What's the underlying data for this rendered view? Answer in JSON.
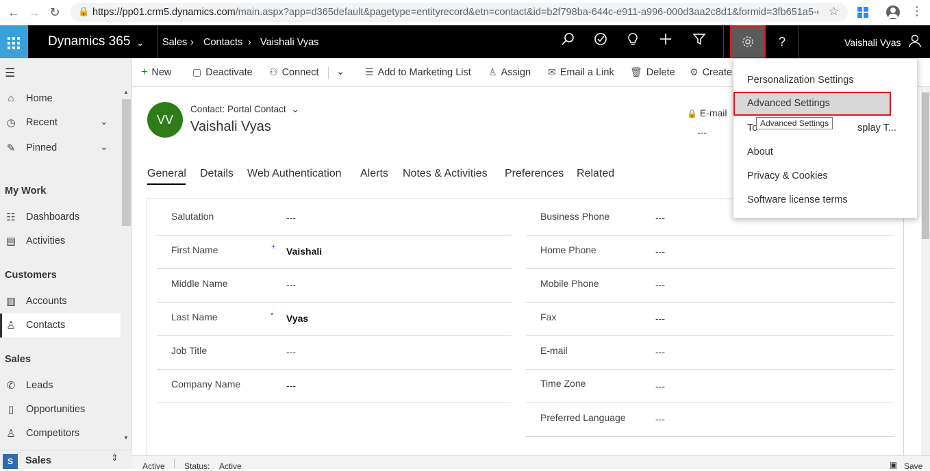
{
  "browser": {
    "url_host": "https://pp01.crm5.dynamics.com",
    "url_path": "/main.aspx?app=d365default&pagetype=entityrecord&etn=contact&id=b2f798ba-644c-e911-a996-000d3aa2c8d1&formid=3fb651a5-c..."
  },
  "topnav": {
    "app_name": "Dynamics 365",
    "breadcrumbs": [
      "Sales",
      "Contacts",
      "Vaishali Vyas"
    ],
    "help": "?",
    "user_name": "Vaishali Vyas"
  },
  "commands": {
    "new": "New",
    "deactivate": "Deactivate",
    "connect": "Connect",
    "add_marketing": "Add to Marketing List",
    "assign": "Assign",
    "email_link": "Email a Link",
    "delete": "Delete",
    "create": "Create"
  },
  "leftnav": {
    "home": "Home",
    "recent": "Recent",
    "pinned": "Pinned",
    "my_work": "My Work",
    "dashboards": "Dashboards",
    "activities": "Activities",
    "customers": "Customers",
    "accounts": "Accounts",
    "contacts": "Contacts",
    "sales": "Sales",
    "leads": "Leads",
    "opportunities": "Opportunities",
    "competitors": "Competitors",
    "area_letter": "S",
    "area_name": "Sales"
  },
  "record": {
    "initials": "VV",
    "form_type": "Contact: Portal Contact",
    "name": "Vaishali Vyas",
    "header_email_label": "E-mail",
    "header_email_value": "---"
  },
  "tabs": [
    "General",
    "Details",
    "Web Authentication",
    "Alerts",
    "Notes & Activities",
    "Preferences",
    "Related"
  ],
  "fields_left": [
    {
      "label": "Salutation",
      "value": "---"
    },
    {
      "label": "First Name",
      "value": "Vaishali"
    },
    {
      "label": "Middle Name",
      "value": "---"
    },
    {
      "label": "Last Name",
      "value": "Vyas"
    },
    {
      "label": "Job Title",
      "value": "---"
    },
    {
      "label": "Company Name",
      "value": "---"
    }
  ],
  "fields_right": [
    {
      "label": "Business Phone",
      "value": "---"
    },
    {
      "label": "Home Phone",
      "value": "---"
    },
    {
      "label": "Mobile Phone",
      "value": "---"
    },
    {
      "label": "Fax",
      "value": "---"
    },
    {
      "label": "E-mail",
      "value": "---"
    },
    {
      "label": "Time Zone",
      "value": "---"
    },
    {
      "label": "Preferred Language",
      "value": "---"
    }
  ],
  "settings_menu": {
    "personalization": "Personalization Settings",
    "advanced": "Advanced Settings",
    "toggle_partial": "To",
    "toggle_tail": "splay T...",
    "about": "About",
    "privacy": "Privacy & Cookies",
    "license": "Software license terms",
    "tooltip": "Advanced Settings"
  },
  "status": {
    "state": "Active",
    "status_label": "Status:",
    "status_value": "Active",
    "save": "Save"
  },
  "colors": {
    "waffle": "#3aa0d9",
    "avatar": "#2e7d17",
    "highlight": "#e0161b"
  }
}
